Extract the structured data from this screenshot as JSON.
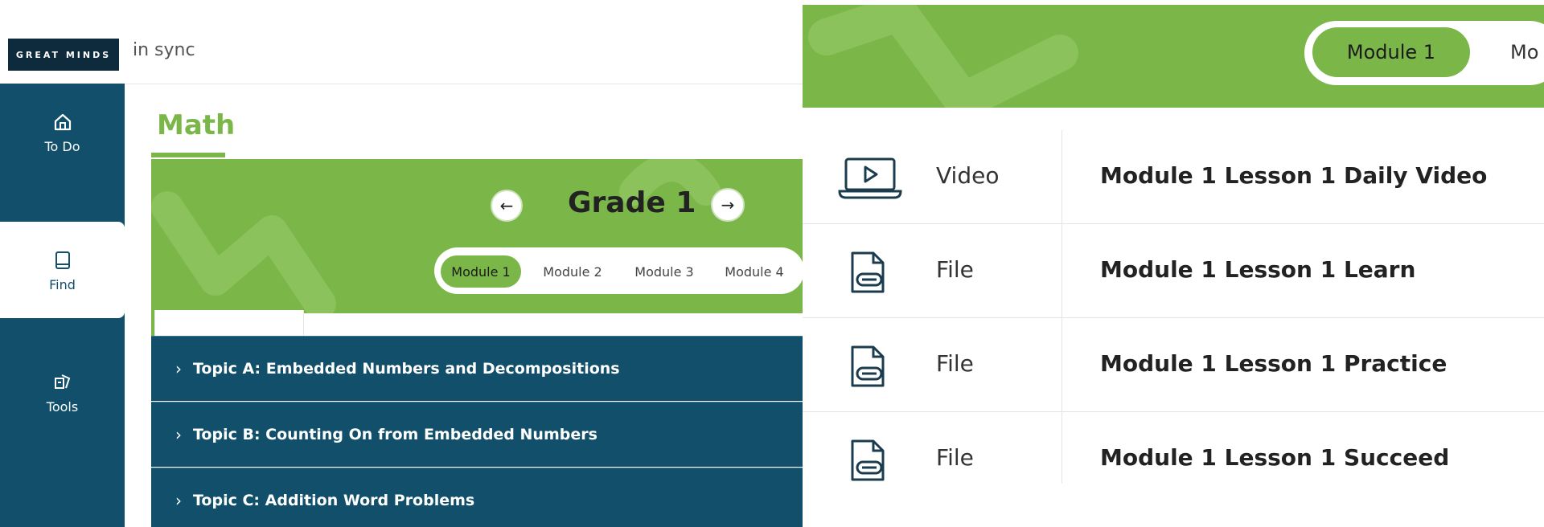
{
  "left": {
    "logo": "GREAT MINDS",
    "app_name": "in sync",
    "sidebar": {
      "items": [
        {
          "label": "To Do",
          "icon": "home-icon"
        },
        {
          "label": "Find",
          "icon": "book-icon"
        },
        {
          "label": "Tools",
          "icon": "tools-icon"
        }
      ]
    },
    "subject": "Math",
    "grade": {
      "title": "Grade 1",
      "prev": "←",
      "next": "→"
    },
    "modules": [
      "Module 1",
      "Module 2",
      "Module 3",
      "Module 4"
    ],
    "selected_module": "Module 1",
    "topics": [
      "Topic A: Embedded Numbers and Decompositions",
      "Topic B: Counting On from Embedded Numbers",
      "Topic C: Addition Word Problems"
    ]
  },
  "right": {
    "tabs": {
      "selected": "Module 1",
      "next_partial": "Mo"
    },
    "rows": [
      {
        "type": "Video",
        "title": "Module 1 Lesson 1 Daily Video",
        "icon": "video-laptop-icon"
      },
      {
        "type": "File",
        "title": "Module 1 Lesson 1 Learn",
        "icon": "file-clip-icon"
      },
      {
        "type": "File",
        "title": "Module 1 Lesson 1 Practice",
        "icon": "file-clip-icon"
      },
      {
        "type": "File",
        "title": "Module 1 Lesson 1 Succeed",
        "icon": "file-clip-icon"
      }
    ]
  },
  "colors": {
    "green": "#7ab648",
    "navy": "#114f6b",
    "logo_bg": "#0e2a3d"
  }
}
